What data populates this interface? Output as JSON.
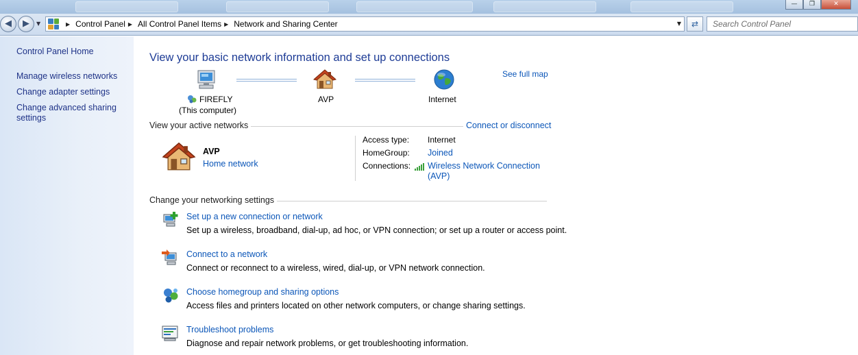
{
  "address_bar": {
    "breadcrumbs": [
      "Control Panel",
      "All Control Panel Items",
      "Network and Sharing Center"
    ],
    "search_placeholder": "Search Control Panel"
  },
  "sidebar": {
    "home": "Control Panel Home",
    "items": [
      {
        "label": "Manage wireless networks"
      },
      {
        "label": "Change adapter settings"
      },
      {
        "label": "Change advanced sharing settings"
      }
    ]
  },
  "main": {
    "heading": "View your basic network information and set up connections",
    "see_full_map": "See full map",
    "map": {
      "computer_name": "FIREFLY",
      "computer_sub": "(This computer)",
      "network_name": "AVP",
      "internet": "Internet"
    },
    "active_networks": {
      "section_title": "View your active networks",
      "connect_link": "Connect or disconnect",
      "network_name": "AVP",
      "network_type": "Home network",
      "access_type_label": "Access type:",
      "access_type_value": "Internet",
      "homegroup_label": "HomeGroup:",
      "homegroup_value": "Joined",
      "connections_label": "Connections:",
      "connection_line1": "Wireless Network Connection",
      "connection_line2": "(AVP)"
    },
    "settings": {
      "section_title": "Change your networking settings",
      "tasks": [
        {
          "title": "Set up a new connection or network",
          "desc": "Set up a wireless, broadband, dial-up, ad hoc, or VPN connection; or set up a router or access point."
        },
        {
          "title": "Connect to a network",
          "desc": "Connect or reconnect to a wireless, wired, dial-up, or VPN network connection."
        },
        {
          "title": "Choose homegroup and sharing options",
          "desc": "Access files and printers located on other network computers, or change sharing settings."
        },
        {
          "title": "Troubleshoot problems",
          "desc": "Diagnose and repair network problems, or get troubleshooting information."
        }
      ]
    }
  },
  "colors": {
    "link": "#0b56b8",
    "heading": "#1e3c96",
    "nav_link": "#1e3287",
    "left_pane": "#dae6f6"
  }
}
